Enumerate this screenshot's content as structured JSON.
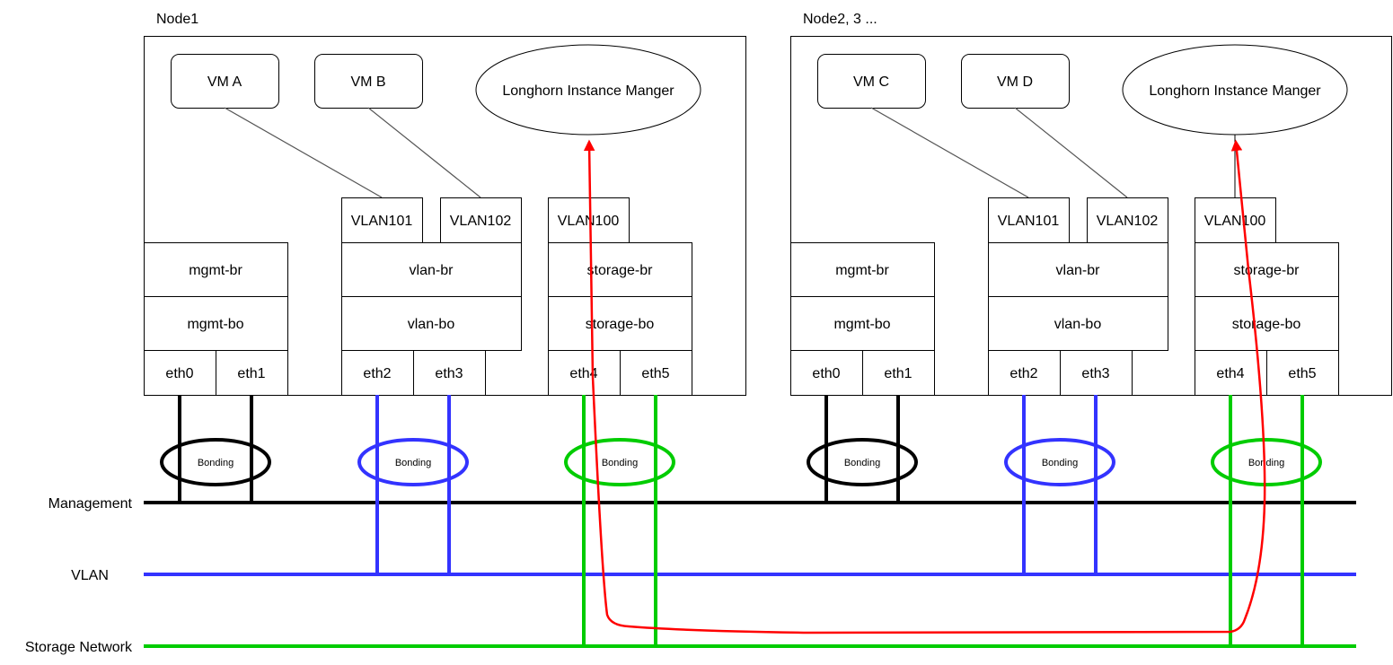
{
  "colors": {
    "management": "#000000",
    "vlan": "#3333ff",
    "storage": "#00cc00",
    "data_path": "#ff0000",
    "vm_link": "#555555"
  },
  "networks": [
    {
      "id": "management",
      "label": "Management"
    },
    {
      "id": "vlan",
      "label": "VLAN"
    },
    {
      "id": "storage",
      "label": "Storage Network"
    }
  ],
  "nodes": [
    {
      "label": "Node1",
      "vms": [
        "VM A",
        "VM B"
      ],
      "instance_manager": "Longhorn Instance Manger",
      "vlan_ifaces": [
        "VLAN101",
        "VLAN102",
        "VLAN100"
      ],
      "groups": [
        {
          "network": "management",
          "bridge": "mgmt-br",
          "bond": "mgmt-bo",
          "nics": [
            "eth0",
            "eth1"
          ],
          "bonding_label": "Bonding"
        },
        {
          "network": "vlan",
          "bridge": "vlan-br",
          "bond": "vlan-bo",
          "nics": [
            "eth2",
            "eth3"
          ],
          "bonding_label": "Bonding"
        },
        {
          "network": "storage",
          "bridge": "storage-br",
          "bond": "storage-bo",
          "nics": [
            "eth4",
            "eth5"
          ],
          "bonding_label": "Bonding"
        }
      ]
    },
    {
      "label": "Node2, 3 ...",
      "vms": [
        "VM C",
        "VM D"
      ],
      "instance_manager": "Longhorn Instance Manger",
      "vlan_ifaces": [
        "VLAN101",
        "VLAN102",
        "VLAN100"
      ],
      "groups": [
        {
          "network": "management",
          "bridge": "mgmt-br",
          "bond": "mgmt-bo",
          "nics": [
            "eth0",
            "eth1"
          ],
          "bonding_label": "Bonding"
        },
        {
          "network": "vlan",
          "bridge": "vlan-br",
          "bond": "vlan-bo",
          "nics": [
            "eth2",
            "eth3"
          ],
          "bonding_label": "Bonding"
        },
        {
          "network": "storage",
          "bridge": "storage-br",
          "bond": "storage-bo",
          "nics": [
            "eth4",
            "eth5"
          ],
          "bonding_label": "Bonding"
        }
      ]
    }
  ]
}
